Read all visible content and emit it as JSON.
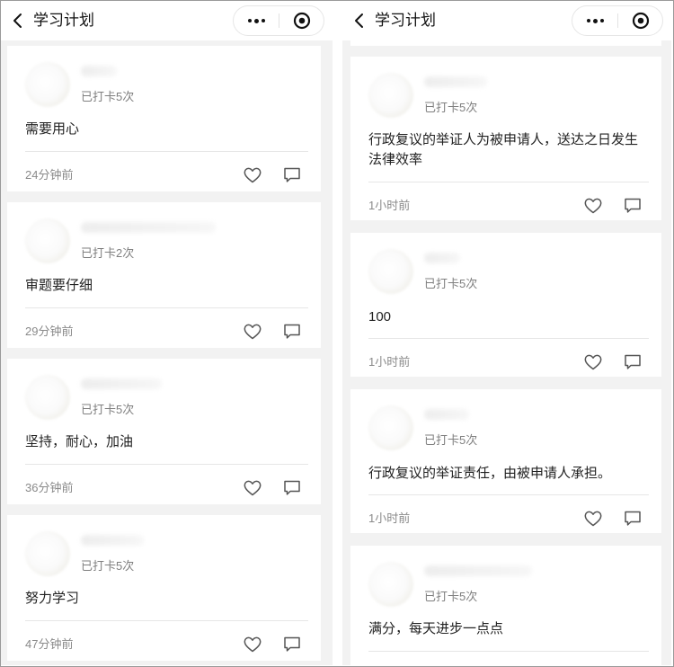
{
  "left_screen": {
    "title": "学习计划",
    "posts": [
      {
        "checkin": "已打卡5次",
        "content": "需要用心",
        "time": "24分钟前"
      },
      {
        "checkin": "已打卡2次",
        "content": "审题要仔细",
        "time": "29分钟前"
      },
      {
        "checkin": "已打卡5次",
        "content": "坚持，耐心，加油",
        "time": "36分钟前"
      },
      {
        "checkin": "已打卡5次",
        "content": "努力学习",
        "time": "47分钟前"
      }
    ]
  },
  "right_screen": {
    "title": "学习计划",
    "posts": [
      {
        "checkin": "已打卡5次",
        "content": "行政复议的举证人为被申请人，送达之日发生法律效率",
        "time": "1小时前"
      },
      {
        "checkin": "已打卡5次",
        "content": "100",
        "time": "1小时前"
      },
      {
        "checkin": "已打卡5次",
        "content": "行政复议的举证责任，由被申请人承担。",
        "time": "1小时前"
      },
      {
        "checkin": "已打卡5次",
        "content": "满分，每天进步一点点",
        "time": ""
      }
    ]
  },
  "icons": {
    "back": "chevron-left-icon",
    "more": "more-dots-icon",
    "close": "target-circle-icon",
    "like": "heart-outline-icon",
    "comment": "comment-bubble-icon"
  }
}
